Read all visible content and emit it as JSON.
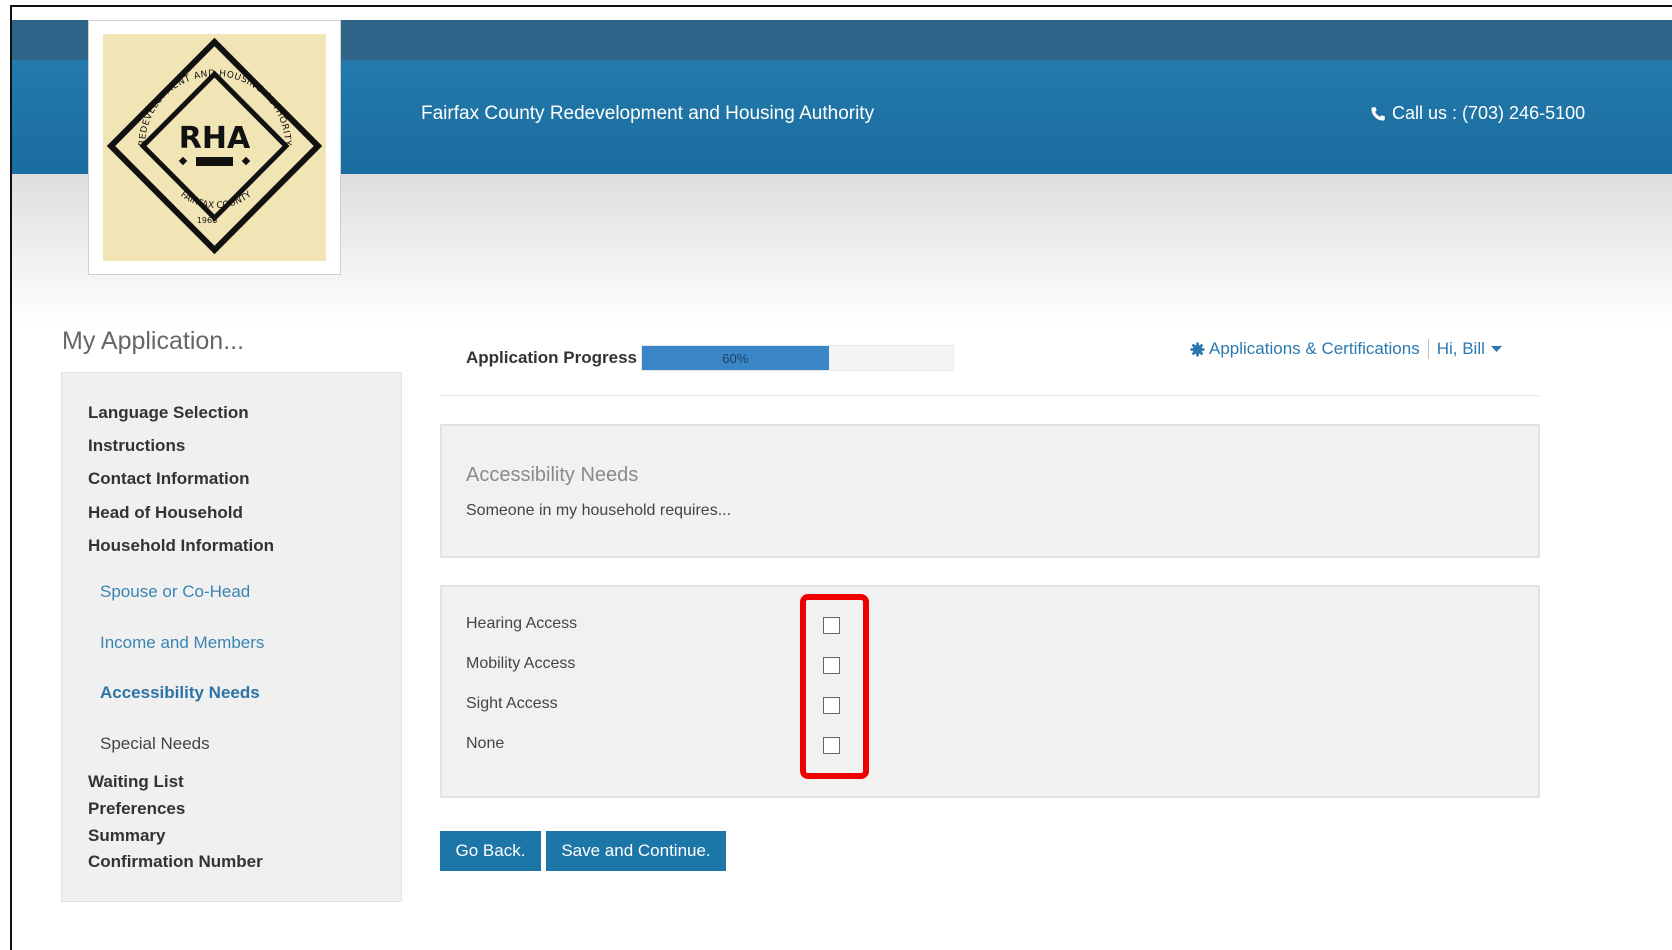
{
  "header": {
    "site_title": "Fairfax County Redevelopment and Housing Authority",
    "call_us": "Call us : (703) 246-5100",
    "logo": {
      "initials": "RHA",
      "arc_top": "REDEVELOPMENT AND HOUSING AUTHORITY",
      "arc_bottom": "FAIRFAX COUNTY",
      "year": "1966"
    }
  },
  "sidebar": {
    "heading": "My Application...",
    "items": [
      {
        "label": "Language Selection",
        "level": 1
      },
      {
        "label": "Instructions",
        "level": 1
      },
      {
        "label": "Contact Information",
        "level": 1
      },
      {
        "label": "Head of Household",
        "level": 1
      },
      {
        "label": "Household Information",
        "level": 1
      },
      {
        "label": "Spouse or Co-Head",
        "level": 2
      },
      {
        "label": "Income and Members",
        "level": 2
      },
      {
        "label": "Accessibility Needs",
        "level": 2,
        "active": true
      },
      {
        "label": "Special Needs",
        "level": 2
      },
      {
        "label": "Waiting List",
        "level": 1
      },
      {
        "label": "Preferences",
        "level": 1
      },
      {
        "label": "Summary",
        "level": 1
      },
      {
        "label": "Confirmation Number",
        "level": 1
      }
    ]
  },
  "progress": {
    "label": "Application Progress",
    "percent": 60,
    "text": "60%"
  },
  "account": {
    "applications_link": "Applications & Certifications",
    "greeting": "Hi, Bill"
  },
  "section": {
    "title": "Accessibility Needs",
    "description": "Someone in my household requires..."
  },
  "options": [
    {
      "label": "Hearing Access",
      "checked": false
    },
    {
      "label": "Mobility Access",
      "checked": false
    },
    {
      "label": "Sight Access",
      "checked": false
    },
    {
      "label": "None",
      "checked": false
    }
  ],
  "buttons": {
    "back": "Go Back.",
    "save": "Save and Continue."
  },
  "colors": {
    "header_dark": "#2f6387",
    "header_blue": "#237aab",
    "link_blue": "#2b79b0",
    "button_blue": "#1d76a8",
    "progress_fill": "#3b86c6",
    "highlight_red": "#ee0000",
    "logo_background": "#f1e4b5"
  }
}
